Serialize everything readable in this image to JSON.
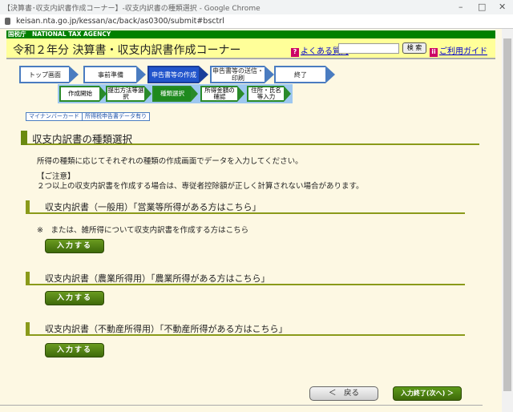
{
  "window": {
    "title": "【決算書･収支内訳書作成コーナー】-収支内訳書の種類選択 - Google Chrome",
    "url": "keisan.nta.go.jp/kessan/ac/back/as0300/submit#bsctrl"
  },
  "header": {
    "agency": "国税庁　NATIONAL TAX AGENCY",
    "title": "令和２年分 決算書・収支内訳書作成コーナー",
    "faq": "よくある質問",
    "search_value": "",
    "search_button": "検 索",
    "guide": "ご利用ガイド"
  },
  "steps": [
    "トップ画面",
    "事前準備",
    "申告書等の作成",
    "申告書等の送信・印刷",
    "終了"
  ],
  "substeps": [
    "作成開始",
    "提出方法等選択",
    "種類選択",
    "所得金額の確認",
    "住所・氏名等入力"
  ],
  "badges": [
    "マイナンバーカード",
    "所得税申告書データ有り"
  ],
  "main": {
    "heading": "収支内訳書の種類選択",
    "intro": "所得の種類に応じてそれぞれの種類の作成画面でデータを入力してください。",
    "note_title": "【ご注意】",
    "note": "２つ以上の収支内訳書を作成する場合は、専従者控除額が正しく計算されない場合があります。",
    "sections": [
      {
        "title": "収支内訳書（一般用）「営業等所得がある方はこちら」",
        "note": "※　または、雑所得について収支内訳書を作成する方はこちら",
        "button": "入力する"
      },
      {
        "title": "収支内訳書（農業所得用）「農業所得がある方はこちら」",
        "button": "入力する"
      },
      {
        "title": "収支内訳書（不動産所得用）「不動産所得がある方はこちら」",
        "button": "入力する"
      }
    ]
  },
  "footer": {
    "back": "＜　戻る",
    "next": "入力終了(次へ) ＞"
  }
}
